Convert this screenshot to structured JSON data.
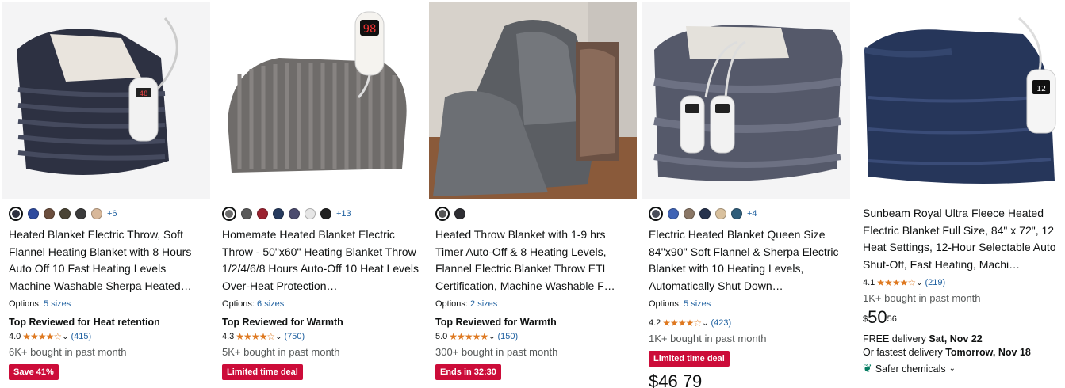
{
  "products": [
    {
      "title": "Heated Blanket Electric Throw, Soft Flannel Heating Blanket with 8 Hours Auto Off 10 Fast Heating Levels Machine Washable Sherpa Heated…",
      "swatches": [
        "#2e3140",
        "#2e4a9e",
        "#6b4e3d",
        "#4a4435",
        "#3b3b3b",
        "#d8b89a"
      ],
      "more_colors": "+6",
      "options_label": "Options:",
      "options_value": "5 sizes",
      "badge": "Top Reviewed for Heat retention",
      "rating": "4.0",
      "stars": "★★★★☆",
      "reviews": "(415)",
      "bought": "6K+ bought in past month",
      "deal": "Save 41%"
    },
    {
      "title": "Homemate Heated Blanket Electric Throw - 50\"x60\" Heating Blanket Throw 1/2/4/6/8 Hours Auto-Off 10 Heat Levels Over-Heat Protection…",
      "swatches": [
        "#6b6b6b",
        "#5a5a5a",
        "#9b2230",
        "#263a5e",
        "#4b4b6e",
        "#e6e6e6",
        "#222222"
      ],
      "more_colors": "+13",
      "options_label": "Options:",
      "options_value": "6 sizes",
      "badge": "Top Reviewed for Warmth",
      "rating": "4.3",
      "stars": "★★★★☆",
      "reviews": "(750)",
      "bought": "5K+ bought in past month",
      "deal": "Limited time deal"
    },
    {
      "title": "Heated Throw Blanket with 1-9 hrs Timer Auto-Off & 8 Heating Levels, Flannel Electric Blanket Throw ETL Certification, Machine Washable F…",
      "swatches": [
        "#555555",
        "#2e2e33"
      ],
      "more_colors": "",
      "options_label": "Options:",
      "options_value": "2 sizes",
      "badge": "Top Reviewed for Warmth",
      "rating": "5.0",
      "stars": "★★★★★",
      "reviews": "(150)",
      "bought": "300+ bought in past month",
      "deal": "Ends in 32:30"
    },
    {
      "title": "Electric Heated Blanket Queen Size 84''x90'' Soft Flannel & Sherpa Electric Blanket with 10 Heating Levels, Automatically Shut Down…",
      "swatches": [
        "#4a4e5a",
        "#3f63b5",
        "#8a7766",
        "#26324d",
        "#d9c19e",
        "#2f5d7a"
      ],
      "more_colors": "+4",
      "options_label": "Options:",
      "options_value": "5 sizes",
      "badge": "",
      "rating": "4.2",
      "stars": "★★★★☆",
      "reviews": "(423)",
      "bought": "1K+ bought in past month",
      "deal": "Limited time deal",
      "price_partial": "$46 79"
    },
    {
      "title": "Sunbeam Royal Ultra Fleece Heated Electric Blanket Full Size, 84\" x 72\", 12 Heat Settings, 12-Hour Selectable Auto Shut-Off, Fast Heating, Machi…",
      "rating": "4.1",
      "stars": "★★★★☆",
      "reviews": "(219)",
      "bought": "1K+ bought in past month",
      "price_symbol": "$",
      "price_whole": "50",
      "price_fraction": "56",
      "delivery_line1_prefix": "FREE delivery ",
      "delivery_line1_date": "Sat, Nov 22",
      "delivery_line2_prefix": "Or fastest delivery ",
      "delivery_line2_date": "Tomorrow, Nov 18",
      "safer": "Safer chemicals"
    }
  ],
  "colors": {
    "link": "#2162a1",
    "deal": "#cc0c39",
    "star": "#de7921",
    "leaf": "#067d62"
  }
}
